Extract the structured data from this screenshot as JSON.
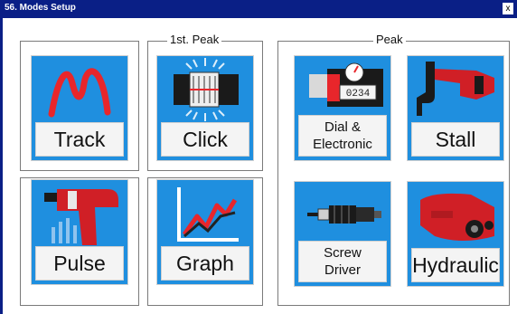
{
  "window": {
    "title": "56. Modes Setup",
    "close_label": "x"
  },
  "groups": {
    "first_peak": "1st. Peak",
    "peak": "Peak"
  },
  "tiles": {
    "track": "Track",
    "click": "Click",
    "pulse": "Pulse",
    "graph": "Graph",
    "dial_line1": "Dial &",
    "dial_line2": "Electronic",
    "stall": "Stall",
    "screw_line1": "Screw",
    "screw_line2": "Driver",
    "hydraulic": "Hydraulic"
  },
  "icons": {
    "dial_readout": "0234"
  },
  "colors": {
    "tile_blue": "#1f8fdf",
    "title_bar": "#0a1f86",
    "accent_red": "#e8262b"
  }
}
